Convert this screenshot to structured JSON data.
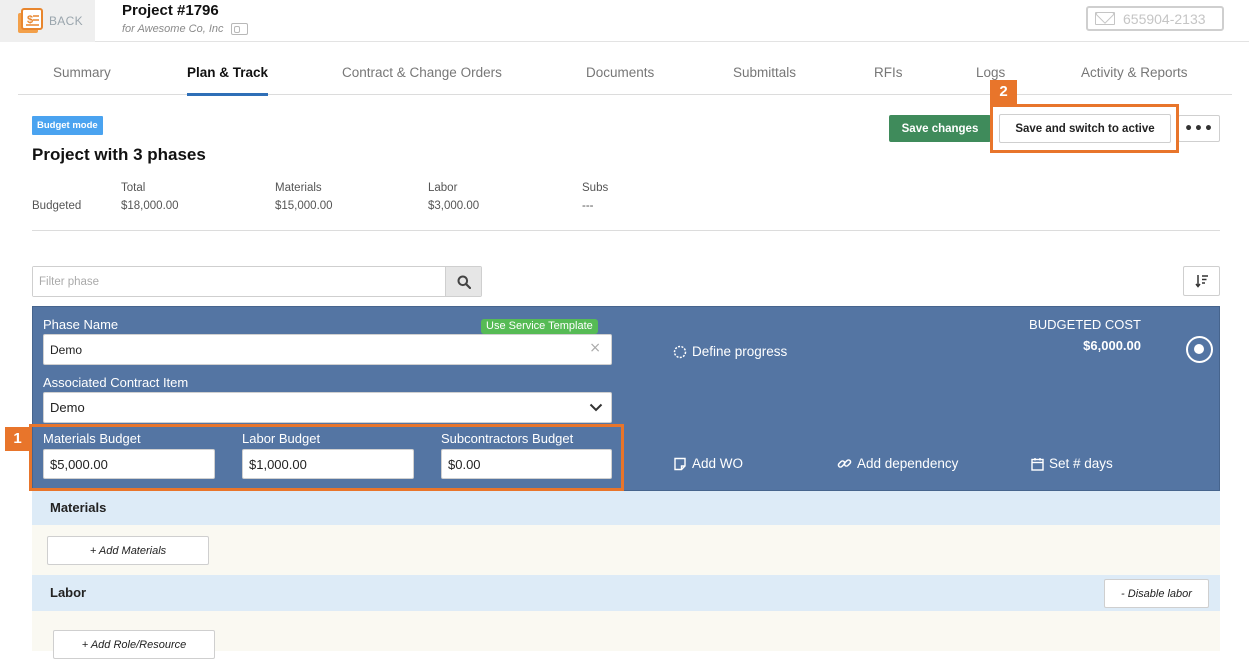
{
  "header": {
    "back_label": "BACK",
    "project_title": "Project #1796",
    "project_subtitle": "for Awesome Co, Inc",
    "phone": "655904-2133"
  },
  "tabs": [
    {
      "label": "Summary",
      "active": false
    },
    {
      "label": "Plan & Track",
      "active": true
    },
    {
      "label": "Contract & Change Orders",
      "active": false
    },
    {
      "label": "Documents",
      "active": false
    },
    {
      "label": "Submittals",
      "active": false
    },
    {
      "label": "RFIs",
      "active": false
    },
    {
      "label": "Logs",
      "active": false
    },
    {
      "label": "Activity & Reports",
      "active": false
    }
  ],
  "page": {
    "mode_badge": "Budget mode",
    "heading": "Project with 3 phases",
    "save_changes_label": "Save changes",
    "switch_active_label": "Save and switch to active",
    "more_label": "•••"
  },
  "callouts": {
    "one": "1",
    "two": "2"
  },
  "totals": {
    "row_label": "Budgeted",
    "columns": [
      {
        "header": "Total",
        "value": "$18,000.00"
      },
      {
        "header": "Materials",
        "value": "$15,000.00"
      },
      {
        "header": "Labor",
        "value": "$3,000.00"
      },
      {
        "header": "Subs",
        "value": "---"
      }
    ]
  },
  "filter": {
    "placeholder": "Filter phase",
    "value": ""
  },
  "phase": {
    "name_label": "Phase Name",
    "service_template_label": "Use Service Template",
    "name_value": "Demo",
    "contract_item_label": "Associated Contract Item",
    "contract_item_value": "Demo",
    "materials_budget_label": "Materials Budget",
    "materials_budget_value": "$5,000.00",
    "labor_budget_label": "Labor Budget",
    "labor_budget_value": "$1,000.00",
    "subs_budget_label": "Subcontractors Budget",
    "subs_budget_value": "$0.00",
    "define_progress_label": "Define progress",
    "add_wo_label": "Add WO",
    "add_dependency_label": "Add dependency",
    "set_days_label": "Set # days",
    "budgeted_cost_label": "BUDGETED COST",
    "budgeted_cost_value": "$6,000.00"
  },
  "sections": {
    "materials_title": "Materials",
    "add_materials_label": "+ Add Materials",
    "labor_title": "Labor",
    "disable_labor_label": "- Disable labor",
    "add_role_label": "+ Add Role/Resource"
  },
  "colors": {
    "accent_blue": "#2f6fb7",
    "phase_panel": "#5475a3",
    "save_green": "#3f8b5b",
    "highlight_orange": "#e8752b",
    "badge_blue": "#4aa3f0"
  }
}
